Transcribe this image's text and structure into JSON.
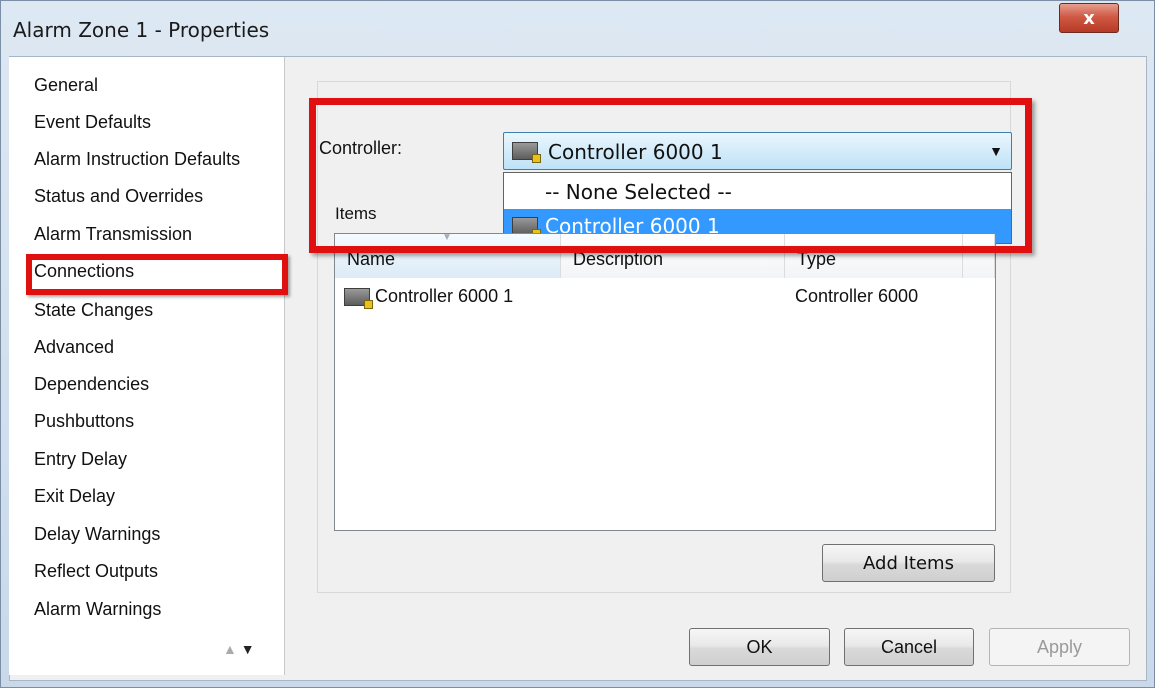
{
  "window": {
    "title": "Alarm Zone 1 - Properties",
    "close_label": "x"
  },
  "nav": {
    "items": [
      {
        "label": "General"
      },
      {
        "label": "Event Defaults"
      },
      {
        "label": "Alarm Instruction Defaults"
      },
      {
        "label": "Status and Overrides"
      },
      {
        "label": "Alarm Transmission"
      },
      {
        "label": "Connections"
      },
      {
        "label": "State Changes"
      },
      {
        "label": "Advanced"
      },
      {
        "label": "Dependencies"
      },
      {
        "label": "Pushbuttons"
      },
      {
        "label": "Entry Delay"
      },
      {
        "label": "Exit Delay"
      },
      {
        "label": "Delay Warnings"
      },
      {
        "label": "Reflect Outputs"
      },
      {
        "label": "Alarm Warnings"
      }
    ],
    "selected": "Connections",
    "scroll_up": "▲",
    "scroll_down": "▼"
  },
  "controller": {
    "label": "Controller:",
    "selected_value": "Controller 6000 1",
    "arrow": "▼",
    "options": [
      {
        "label": "-- None Selected --"
      },
      {
        "label": "Controller 6000 1"
      }
    ]
  },
  "items": {
    "label": "Items",
    "columns": [
      "Name",
      "Description",
      "Type"
    ],
    "rows": [
      {
        "name": "Controller 6000 1",
        "description": "",
        "type": "Controller 6000"
      }
    ],
    "add_button": "Add Items"
  },
  "footer": {
    "ok": "OK",
    "cancel": "Cancel",
    "apply": "Apply"
  },
  "colors": {
    "highlight": "#e01010",
    "selection": "#3399ff"
  }
}
